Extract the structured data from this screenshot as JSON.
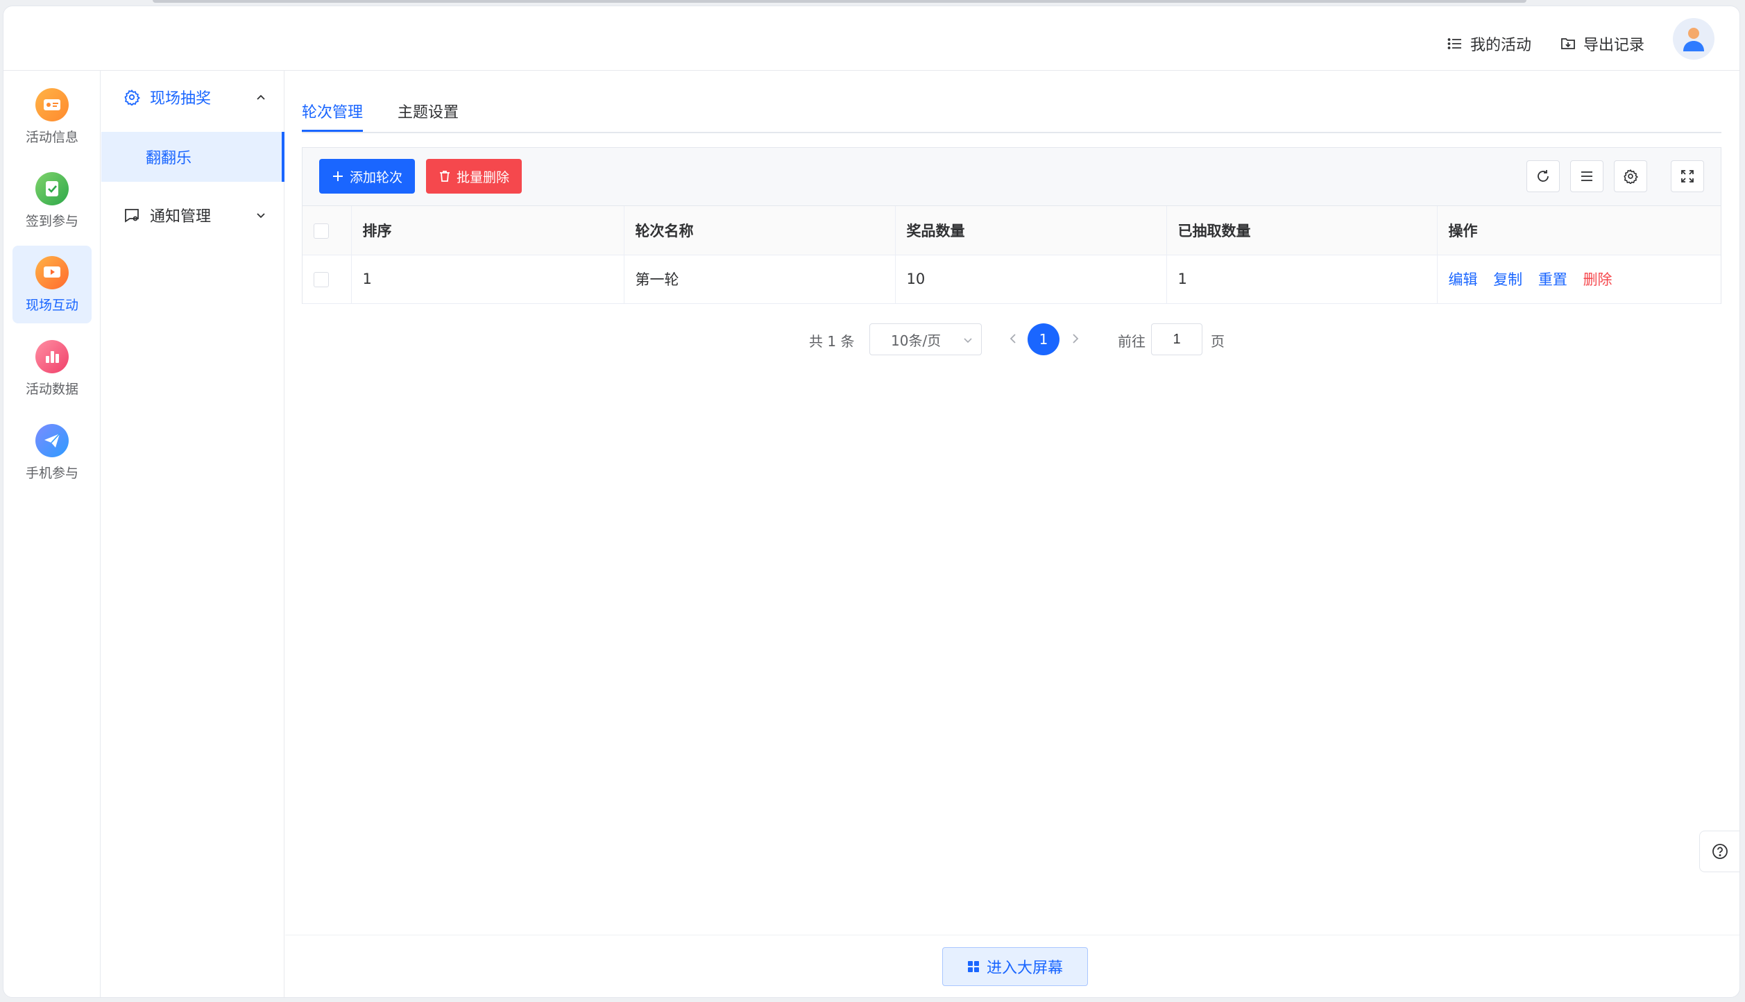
{
  "header": {
    "my_activity": "我的活动",
    "export_records": "导出记录"
  },
  "rail": {
    "items": [
      {
        "label": "活动信息",
        "icon": "activity-info-icon",
        "color": "#ff9d2e"
      },
      {
        "label": "签到参与",
        "icon": "checkin-icon",
        "color": "#3cb95a"
      },
      {
        "label": "现场互动",
        "icon": "live-interaction-icon",
        "color": "#ff7a2e"
      },
      {
        "label": "活动数据",
        "icon": "activity-data-icon",
        "color": "#f5487a"
      },
      {
        "label": "手机参与",
        "icon": "mobile-join-icon",
        "color": "#2e7bff"
      }
    ],
    "active_index": 2
  },
  "submenu": {
    "group1": "现场抽奖",
    "group1_sub": "翻翻乐",
    "group2": "通知管理"
  },
  "tabs": [
    "轮次管理",
    "主题设置"
  ],
  "toolbar": {
    "add_label": "添加轮次",
    "batch_delete_label": "批量删除"
  },
  "table": {
    "headers": [
      "排序",
      "轮次名称",
      "奖品数量",
      "已抽取数量",
      "操作"
    ],
    "rows": [
      {
        "order": "1",
        "name": "第一轮",
        "prizes": "10",
        "drawn": "1"
      }
    ],
    "ops": [
      "编辑",
      "复制",
      "重置",
      "删除"
    ]
  },
  "pagination": {
    "total": "共 1 条",
    "page_size": "10条/页",
    "current_page": "1",
    "goto_label": "前往",
    "goto_value": "1",
    "page_suffix": "页"
  },
  "footer": {
    "bigscreen_label": "进入大屏幕"
  },
  "colors": {
    "primary": "#1a66ff",
    "danger": "#f5484d"
  }
}
